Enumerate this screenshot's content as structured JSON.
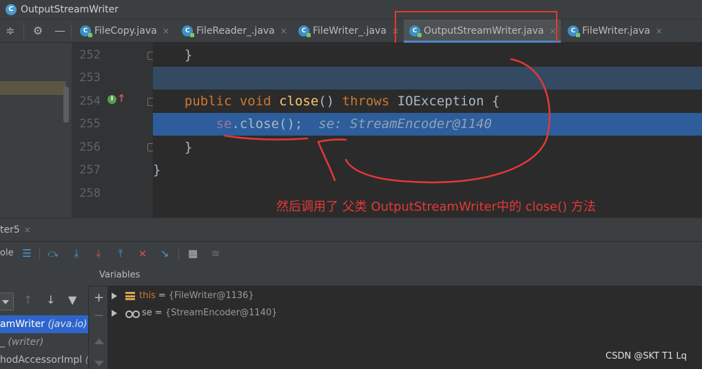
{
  "window": {
    "title": "OutputStreamWriter",
    "app_icon_letter": "C"
  },
  "tabs": [
    {
      "label": "FileCopy.java",
      "active": false
    },
    {
      "label": "FileReader_.java",
      "active": false
    },
    {
      "label": "FileWriter_.java",
      "active": false
    },
    {
      "label": "OutputStreamWriter.java",
      "active": true
    },
    {
      "label": "FileWriter.java",
      "active": false
    }
  ],
  "tab_close_glyph": "×",
  "file_icon_letter": "C",
  "gutter": {
    "line_numbers": [
      "252",
      "253",
      "254",
      "255",
      "256",
      "257",
      "258"
    ],
    "override_marker": "I",
    "override_arrow": "↑"
  },
  "code": {
    "line252": "    }",
    "line254": {
      "indent": "    ",
      "kw_public": "public",
      "kw_void": "void",
      "method": "close",
      "parens": "()",
      "kw_throws": "throws",
      "exception": "IOException {"
    },
    "line255": {
      "indent": "        ",
      "field": "se",
      "call": ".close();",
      "hint": "se: StreamEncoder@1140"
    },
    "line256": "    }",
    "line257": "}"
  },
  "annotation": "然后调用了 父类 OutputStreamWriter中的 close() 方法",
  "debug": {
    "tab_label": "ter5",
    "toolbar_partial_label": "ole",
    "frames": [
      {
        "name": "amWriter",
        "pkg": "(java.io)",
        "selected": true
      },
      {
        "name": "_",
        "pkg": "(writer)",
        "selected": false
      },
      {
        "name": "hodAccessorImpl",
        "pkg": "(s",
        "selected": false
      }
    ],
    "variables_header": "Variables",
    "variables": [
      {
        "name": "this",
        "value": "{FileWriter@1136}",
        "kind": "field"
      },
      {
        "name": "se",
        "value": "{StreamEncoder@1140}",
        "kind": "local"
      }
    ]
  },
  "watermark": "CSDN @SKT T1 Lq",
  "colors": {
    "annotation_red": "#e53935",
    "keyword": "#cc7832",
    "method": "#ffc66d",
    "field": "#9876aa",
    "exec_line": "#2d5d9b",
    "accent": "#4a88c7"
  }
}
